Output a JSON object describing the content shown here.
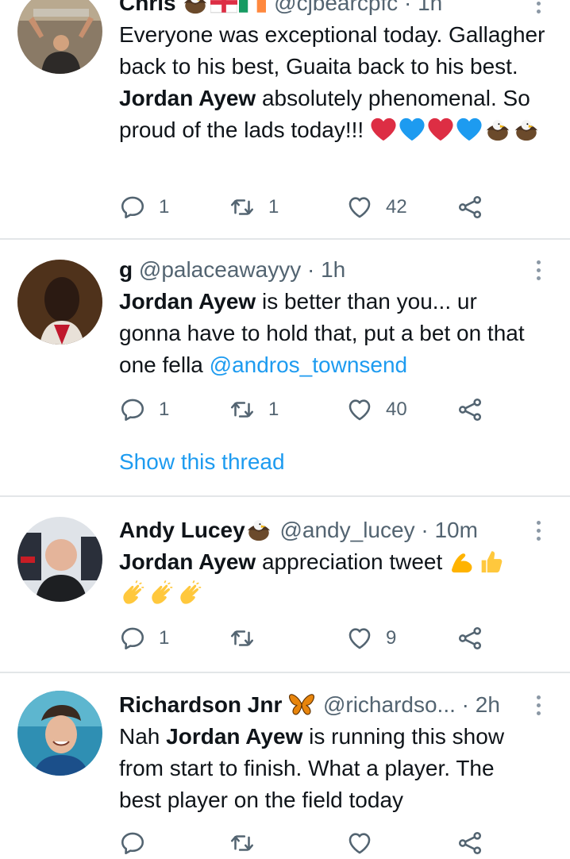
{
  "tweets": [
    {
      "name": "Chris",
      "handle": "@cjbearcpfc",
      "sep": "·",
      "time": "1h",
      "body": {
        "t1": "Everyone was exceptional today. Gallagher back to his best, Guaita back to his best. ",
        "b1": "Jordan Ayew",
        "t2": " absolutely phenomenal. So proud of the lads today!!! "
      },
      "emoji": [
        "red-heart",
        "blue-heart",
        "red-heart",
        "blue-heart",
        "eagle",
        "eagle"
      ],
      "stats": {
        "replies": "1",
        "retweets": "1",
        "likes": "42"
      }
    },
    {
      "name": "g",
      "handle": "@palaceawayyy",
      "sep": "·",
      "time": "1h",
      "body": {
        "b1": "Jordan Ayew",
        "t1": " is better than you... ur gonna have to hold that, put a bet on that one fella ",
        "mention": "@andros_townsend"
      },
      "stats": {
        "replies": "1",
        "retweets": "1",
        "likes": "40"
      },
      "thread_link": "Show this thread"
    },
    {
      "name": "Andy Lucey",
      "handle": "@andy_lucey",
      "sep": "·",
      "time": "10m",
      "body": {
        "b1": "Jordan  Ayew",
        "t1": " appreciation tweet "
      },
      "emoji": [
        "flexed-biceps",
        "thumbs-up",
        "clapping-hands",
        "clapping-hands",
        "clapping-hands"
      ],
      "stats": {
        "replies": "1",
        "retweets": "",
        "likes": "9"
      }
    },
    {
      "name": "Richardson Jnr",
      "handle": "@richardso...",
      "sep": "·",
      "time": "2h",
      "body": {
        "t1": "Nah ",
        "b1": "Jordan Ayew",
        "t2": " is running this show from start to finish. What a player. The best player on the field today"
      }
    }
  ],
  "colors": {
    "accent": "#1d9bf0",
    "muted": "#536471",
    "separator": "#e3e6e8",
    "heart_red": "#e0245e",
    "heart_blue": "#1da1f2"
  }
}
